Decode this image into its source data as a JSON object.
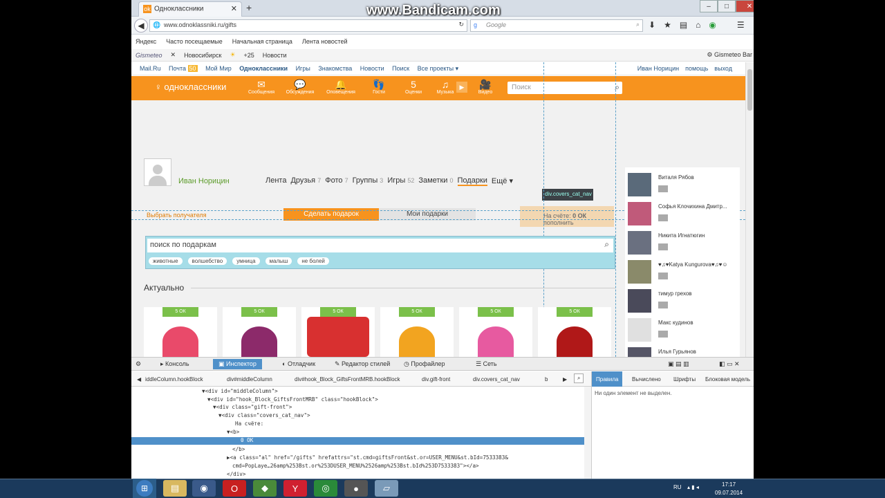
{
  "watermark": "www.Bandicam.com",
  "browser": {
    "tab_title": "Одноклассники",
    "tab_icon": "ok-favicon-icon",
    "url": "www.odnoklassniki.ru/gifts",
    "search_engine_placeholder": "Google",
    "bookmarks": [
      "Яндекс",
      "Часто посещаемые",
      "Начальная страница",
      "Лента новостей"
    ],
    "gismeteo": {
      "label": "Gismeteo",
      "city": "Новосибирск",
      "temp": "+25",
      "news": "Новости",
      "bar": "Gismeteo Bar"
    }
  },
  "mailru": {
    "links": [
      "Mail.Ru",
      "Почта",
      "Мой Мир",
      "Одноклассники",
      "Игры",
      "Знакомства",
      "Новости",
      "Поиск",
      "Все проекты ▾"
    ],
    "mail_count": "50",
    "user": "Иван Норицин",
    "help": "помощь",
    "logout": "выход"
  },
  "ok": {
    "logo": "одноклассники",
    "icons": [
      {
        "label": "Сообщения",
        "glyph": "✉"
      },
      {
        "label": "Обсуждения",
        "glyph": "💬"
      },
      {
        "label": "Оповещения",
        "glyph": "🔔"
      },
      {
        "label": "Гости",
        "glyph": "👣"
      },
      {
        "label": "Оценки",
        "glyph": "5"
      },
      {
        "label": "Музыка",
        "glyph": "♫"
      },
      {
        "label": "Видео",
        "glyph": "🎥"
      }
    ],
    "search_placeholder": "Поиск"
  },
  "profile": {
    "name": "Иван Норицин",
    "nav": [
      {
        "label": "Лента",
        "count": ""
      },
      {
        "label": "Друзья",
        "count": "7"
      },
      {
        "label": "Фото",
        "count": "7"
      },
      {
        "label": "Группы",
        "count": "3"
      },
      {
        "label": "Игры",
        "count": "52"
      },
      {
        "label": "Заметки",
        "count": "0"
      },
      {
        "label": "Подарки",
        "count": ""
      },
      {
        "label": "Ещё ▾",
        "count": ""
      }
    ]
  },
  "gifts": {
    "choose_recipient": "Выбрать получателя",
    "make_gift": "Сделать подарок",
    "my_gifts": "Мои подарки",
    "balance_label": "На счёте:",
    "balance_value": "0 ОК",
    "top_up": "пополнить",
    "tooltip": "div.covers_cat_nav",
    "search_placeholder": "поиск по подаркам",
    "tags": [
      "животные",
      "волшебство",
      "умница",
      "малыш",
      "не болей"
    ],
    "section": "Актуально",
    "items": [
      {
        "price": "5 ОК",
        "color": "#e94a6a"
      },
      {
        "price": "5 ОК",
        "color": "#8c2a6a"
      },
      {
        "price": "5 ОК",
        "color": "#d83030"
      },
      {
        "price": "5 ОК",
        "color": "#f2a420"
      },
      {
        "price": "5 ОК",
        "color": "#e75aa0"
      },
      {
        "price": "5 ОК",
        "color": "#b01818"
      }
    ]
  },
  "friends": [
    "Виталя Рябов",
    "Софья Клочихина Дмитр...",
    "Никита Игнатюгин",
    "♥♫♥Katya Kungurova♥♫♥☺",
    "тимур грехов",
    "Макс кудинов",
    "Илья Гурьянов"
  ],
  "devtools": {
    "tabs": [
      "Консоль",
      "Инспектор",
      "Отладчик",
      "Редактор стилей",
      "Профайлер",
      "Сеть"
    ],
    "active": "Инспектор",
    "crumbs": [
      "iddleColumn.hookBlock",
      "div#middleColumn",
      "div#hook_Block_GiftsFrontMRB.hookBlock",
      "div.gift-front",
      "div.covers_cat_nav",
      "b"
    ],
    "side_tabs": [
      "Правила",
      "Вычислено",
      "Шрифты",
      "Блоковая модель"
    ],
    "no_element": "Ни один элемент не выделен.",
    "code": [
      "▼<div id=\"middleColumn\">",
      "▼<div id=\"hook_Block_GiftsFrontMRB\" class=\"hookBlock\">",
      "▼<div class=\"gift-front\">",
      "▼<div class=\"covers_cat_nav\">",
      "На счёте:",
      "▼<b>",
      "0 OK",
      "</b>",
      "▶<a class=\"al\" href=\"/gifts\" hrefattrs=\"st.cmd=giftsFront&st.or=USER_MENU&st.bId=7533383&",
      "cmd=PopLaye…26amp%253Bst.or%253DUSER_MENU%2526amp%253Bst.bId%253D7533383\"></a>",
      "</div>"
    ]
  },
  "tray": {
    "lang": "RU",
    "time": "17:17",
    "date": "09.07.2014"
  }
}
